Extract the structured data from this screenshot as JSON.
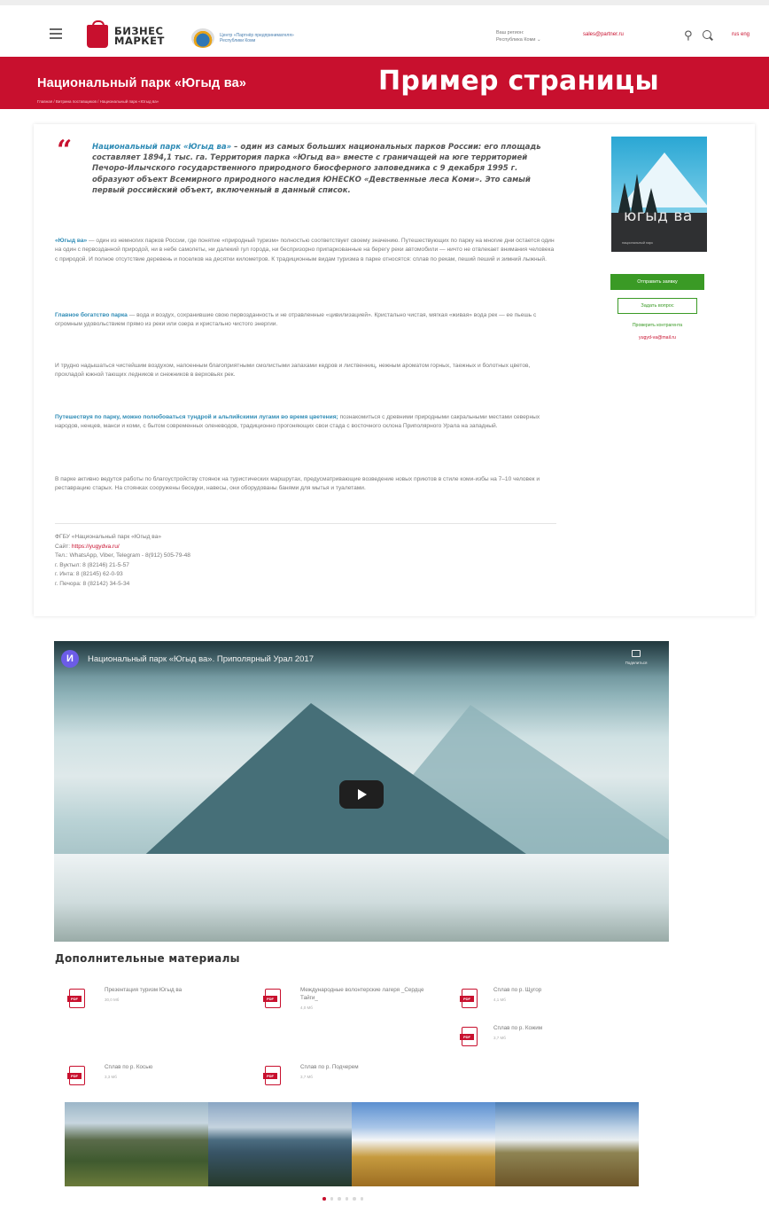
{
  "header": {
    "logo_line1": "БИЗНЕС",
    "logo_line2": "МАРКЕТ",
    "partner_text": "Центр «Партнёр предпринимателя» Республики Коми",
    "region_label": "Ваш регион:",
    "region_value": "Республика Коми ⌄",
    "email": "sales@partner.ru",
    "lang": "rus eng"
  },
  "banner": {
    "title": "Национальный парк «Югыд ва»",
    "breadcrumb": "Главная  /  Витрина поставщиков  /  Национальный парк «Югыд ва»",
    "overlay": "Пример страницы"
  },
  "content": {
    "quote_mark": "“",
    "quote_lead": "Национальный парк «Югыд ва»",
    "quote_text": " – один из самых больших национальных парков России: его площадь составляет 1894,1 тыс. га. Территория парка «Югыд ва» вместе с граничащей на юге территорией Печоро-Илычского государственного природного биосферного заповедника с 9 декабря 1995 г. образуют объект Всемирного природного наследия ЮНЕСКО «Девственные леса Коми». Это самый первый российский объект, включенный в данный список.",
    "p1_lead": "«Югыд ва»",
    "p1_text": " — один из немногих парков России, где понятие «природный туризм» полностью соответствует своему значению. Путешествующих по парку на многие дни остается один на один с первозданной природой, ни в небе самолеты, ни далекий гул города, ни беспризорно припаркованные на берегу реки автомобили — ничто не отвлекает внимания человека с природой. И полное отсутствие деревень и поселков на десятки километров. К традиционным видам туризма в парке относятся: сплав по рекам, пеший пеший и зимний лыжный.",
    "p2_lead": "Главное богатство парка",
    "p2_text": " — вода и воздух, сохранившие свою первозданность и не отравленные «цивилизацией». Кристально чистая, мягкая «живая» вода рек — ее пьешь с огромным удовольствием прямо из реки или озера и кристально чистого энергии.",
    "p3_text": "И трудно надышаться чистейшим воздухом, напоенным благоприятными смолистыми запахами кедров и лиственниц, нежным ароматом горных, таежных и болотных цветов, прохладой южной тающих ледников и снежников в верховьях рек.",
    "p4_lead": "Путешествуя по парку, можно полюбоваться тундрой и альпийскими лугами во время цветения;",
    "p4_text": " познакомиться с древними природными сакральными местами северных народов, ненцев, манси и коми, с бытом современных оленеводов, традиционно прогоняющих свои стада с восточного склона Приполярного Урала на западный.",
    "p5_text": "В парке активно ведутся работы по благоустройству стоянок на туристических маршрутах, предусматривающие возведение новых приютов в стиле коми-избы на 7–10 человек и реставрацию старых. На стоянках сооружены беседки, навесы, они оборудованы банями для мытья и туалетами.",
    "contacts": {
      "org": "ФГБУ «Национальный парк «Югыд ва»",
      "site_label": "Сайт: ",
      "site": "https://yugydva.ru/",
      "phone": "Тел.: WhatsApp, Viber, Telegram - 8(912) 505-79-48",
      "vuktyl": "г. Вуктыл: 8 (82146) 21-5-57",
      "inta": "г. Инта: 8 (82145) 62-0-93",
      "pechora": "г. Печора: 8 (82142) 34-5-34"
    }
  },
  "side": {
    "park_name": "югыд ва",
    "park_sub": "национальный парк",
    "order_button": "Отправить заявку",
    "question_button": "Задать вопрос",
    "check_link": "Проверить контрагента",
    "email": "yugyd-va@mail.ru"
  },
  "video": {
    "avatar_letter": "И",
    "title": "Национальный парк «Югыд ва». Приполярный Урал 2017",
    "share_label": "Поделиться"
  },
  "materials": {
    "title": "Дополнительные материалы",
    "items": [
      {
        "name": "Презентация туризм Югыд ва",
        "size": "30,0 Мб"
      },
      {
        "name": "Международные волонтерские лагеря _Сердце Тайги_",
        "size": "4,0 Мб"
      },
      {
        "name": "Сплав по р. Щугор",
        "size": "4,1 Мб"
      },
      {
        "name": "Сплав по р. Кожим",
        "size": "3,7 Мб"
      },
      {
        "name": "Сплав по р. Косью",
        "size": "3,3 Мб"
      },
      {
        "name": "Сплав по р. Подчерем",
        "size": "3,7 Мб"
      }
    ],
    "pdf_tag": "PDF"
  },
  "gallery": {
    "dots_total": 6,
    "active_dot": 1
  }
}
